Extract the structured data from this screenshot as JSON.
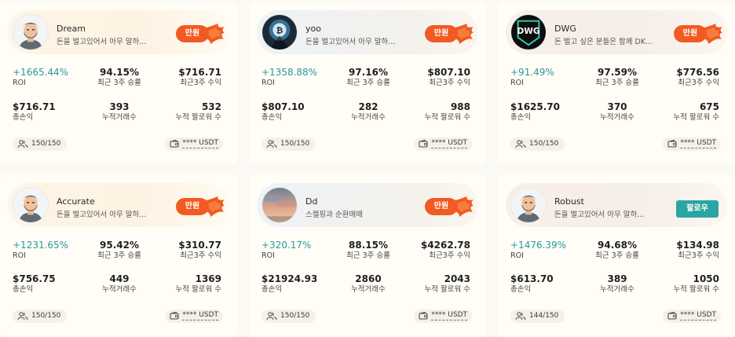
{
  "cards": [
    {
      "name": "Dream",
      "bio": "돈을 벌고있어서 아무 말하...",
      "avatar": "bearded-man-avatar",
      "badge": "만원",
      "action": "badge",
      "roi": "+1665.44%",
      "roi_label": "ROI",
      "win_rate": "94.15%",
      "win_rate_label": "최근 3주 승률",
      "profit3w": "$716.71",
      "profit3w_label": "최근3주 수익",
      "total_profit": "$716.71",
      "total_profit_label": "총손익",
      "trades": "393",
      "trades_label": "누적거래수",
      "followers": "532",
      "followers_label": "누적 팔로워 수",
      "capacity": "150/150",
      "balance": "**** USDT"
    },
    {
      "name": "yoo",
      "bio": "돈을 벌고있어서 아무 말하...",
      "avatar": "bitcoin-avatar",
      "badge": "만원",
      "action": "badge",
      "roi": "+1358.88%",
      "roi_label": "ROI",
      "win_rate": "97.16%",
      "win_rate_label": "최근 3주 승률",
      "profit3w": "$807.10",
      "profit3w_label": "최근3주 수익",
      "total_profit": "$807.10",
      "total_profit_label": "총손익",
      "trades": "282",
      "trades_label": "누적거래수",
      "followers": "988",
      "followers_label": "누적 팔로워 수",
      "capacity": "150/150",
      "balance": "**** USDT"
    },
    {
      "name": "DWG",
      "bio": "돈 벌고 싶은 분들은 함께 DK...",
      "avatar": "dwg-logo-avatar",
      "badge": "만원",
      "action": "badge",
      "roi": "+91.49%",
      "roi_label": "ROI",
      "win_rate": "97.59%",
      "win_rate_label": "최근 3주 승률",
      "profit3w": "$776.56",
      "profit3w_label": "최근3주 수익",
      "total_profit": "$1625.70",
      "total_profit_label": "총손익",
      "trades": "370",
      "trades_label": "누적거래수",
      "followers": "675",
      "followers_label": "누적 팔로워 수",
      "capacity": "150/150",
      "balance": "**** USDT"
    },
    {
      "name": "Accurate",
      "bio": "돈을 벌고있어서 아무 말하...",
      "avatar": "bearded-man-avatar",
      "badge": "만원",
      "action": "badge",
      "roi": "+1231.65%",
      "roi_label": "ROI",
      "win_rate": "95.42%",
      "win_rate_label": "최근 3주 승률",
      "profit3w": "$310.77",
      "profit3w_label": "최근3주 수익",
      "total_profit": "$756.75",
      "total_profit_label": "총손익",
      "trades": "449",
      "trades_label": "누적거래수",
      "followers": "1369",
      "followers_label": "누적 팔로워 수",
      "capacity": "150/150",
      "balance": "**** USDT"
    },
    {
      "name": "Dd",
      "bio": "스켈핑과 순환매매",
      "avatar": "sunset-sky-avatar",
      "badge": "만원",
      "action": "badge",
      "roi": "+320.17%",
      "roi_label": "ROI",
      "win_rate": "88.15%",
      "win_rate_label": "최근 3주 승률",
      "profit3w": "$4262.78",
      "profit3w_label": "최근3주 수익",
      "total_profit": "$21924.93",
      "total_profit_label": "총손익",
      "trades": "2860",
      "trades_label": "누적거래수",
      "followers": "2043",
      "followers_label": "누적 팔로워 수",
      "capacity": "150/150",
      "balance": "**** USDT"
    },
    {
      "name": "Robust",
      "bio": "돈을 벌고있어서 아무 말하...",
      "avatar": "bearded-man-avatar",
      "badge": "",
      "action": "follow",
      "follow_label": "팔로우",
      "roi": "+1476.39%",
      "roi_label": "ROI",
      "win_rate": "94.68%",
      "win_rate_label": "최근 3주 승률",
      "profit3w": "$134.98",
      "profit3w_label": "최근3주 수익",
      "total_profit": "$613.70",
      "total_profit_label": "총손익",
      "trades": "389",
      "trades_label": "누적거래수",
      "followers": "1050",
      "followers_label": "누적 팔로워 수",
      "capacity": "144/150",
      "balance": "**** USDT"
    }
  ],
  "colors": {
    "accent_teal": "#2a9a9b",
    "badge_orange": "#f15a22",
    "follow_button": "#2aa5a3"
  }
}
